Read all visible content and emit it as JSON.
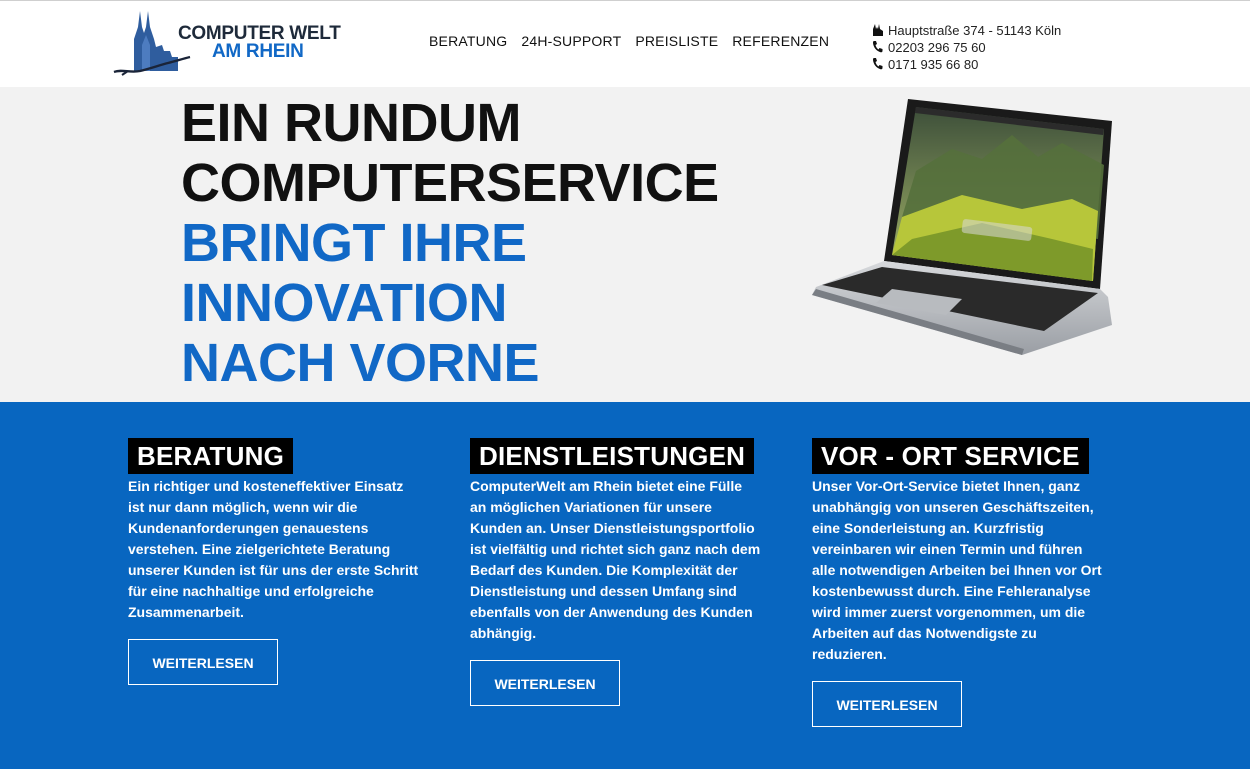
{
  "brand": {
    "line1": "COMPUTER WELT",
    "line2": "AM RHEIN"
  },
  "nav": [
    {
      "label": "BERATUNG"
    },
    {
      "label": "24H-SUPPORT"
    },
    {
      "label": "PREISLISTE"
    },
    {
      "label": "REFERENZEN"
    }
  ],
  "contact": {
    "address": "Hauptstraße 374 - 51143 Köln",
    "phone1": "02203 296 75 60",
    "phone2": "0171 935 66 80"
  },
  "hero": {
    "line1": "EIN RUNDUM",
    "line2": "COMPUTERSERVICE",
    "line3": "BRINGT IHRE",
    "line4": "INNOVATION",
    "line5": "NACH VORNE"
  },
  "services": [
    {
      "title": "BERATUNG",
      "text": "Ein richtiger und kosteneffektiver Einsatz ist nur dann möglich, wenn wir die Kundenanforderungen genauestens verstehen. Eine zielgerichtete Beratung unserer Kunden ist für uns der erste Schritt für eine nachhaltige und erfolgreiche Zusammenarbeit.",
      "button": "WEITERLESEN"
    },
    {
      "title": "DIENSTLEISTUNGEN",
      "text": "ComputerWelt am Rhein bietet eine Fülle an möglichen Variationen für unsere Kunden an. Unser Dienstleistungsportfolio ist vielfältig und richtet sich ganz nach dem Bedarf des Kunden. Die Komplexität der Dienstleistung und dessen Umfang sind ebenfalls von der Anwendung des Kunden abhängig.",
      "button": "WEITERLESEN"
    },
    {
      "title": "VOR - ORT SERVICE",
      "text": "Unser Vor-Ort-Service bietet Ihnen, ganz unabhängig von unseren Geschäftszeiten, eine Sonderleistung an. Kurzfristig vereinbaren wir einen Termin und führen alle notwendigen Arbeiten bei Ihnen vor Ort kostenbewusst durch. Eine Fehleranalyse wird immer zuerst vorgenommen, um die Arbeiten auf das Notwendigste zu reduzieren.",
      "button": "WEITERLESEN"
    }
  ],
  "colors": {
    "accent": "#1168c6",
    "band": "#0866c0",
    "hero_bg": "#f2f2f2"
  },
  "icons": {
    "address": "cathedral-icon",
    "phone": "phone-icon"
  }
}
